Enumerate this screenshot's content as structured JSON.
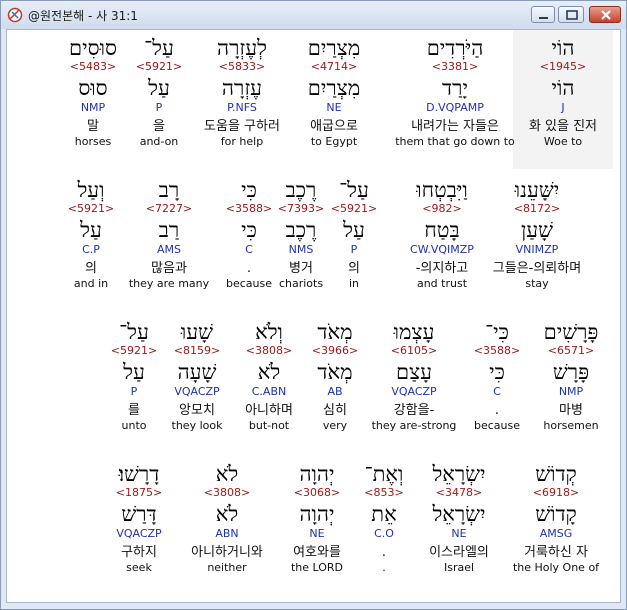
{
  "window": {
    "title": "@원전본해 - 사 31:1"
  },
  "rows": [
    [
      {
        "heb": "הוֹי",
        "num": "<1945>",
        "lex": "הוֹי",
        "morph": "J",
        "kor": "화 있을 진저",
        "eng": "Woe to",
        "highlight": true
      },
      {
        "heb": "הַיֹּרְדִים",
        "num": "<3381>",
        "lex": "יָרַד",
        "morph": "D.VQPAMP",
        "kor": "내려가는 자들은",
        "eng": "them that go down to"
      },
      {
        "heb": "מִצְרַיִם",
        "num": "<4714>",
        "lex": "מִצְרַיִם",
        "morph": "NE",
        "kor": "애굽으로",
        "eng": "to Egypt"
      },
      {
        "heb": "לְעֶזְרָה",
        "num": "<5833>",
        "lex": "עֶזְרָה",
        "morph": "P.NFS",
        "kor": "도움을 구하러",
        "eng": "for help"
      },
      {
        "heb": "עַל־",
        "num": "<5921>",
        "lex": "עַל",
        "morph": "P",
        "kor": "을",
        "eng": "and-on"
      },
      {
        "heb": "סוּסִים",
        "num": "<5483>",
        "lex": "סוּס",
        "morph": "NMP",
        "kor": "말",
        "eng": "horses"
      }
    ],
    [
      {
        "heb": "יִשָּׁעֵנוּ",
        "num": "<8172>",
        "lex": "שָׁעַן",
        "morph": "VNIMZP",
        "kor": "그들은-의뢰하며",
        "eng": "stay"
      },
      {
        "heb": "וַיִּבְטְחוּ",
        "num": "<982>",
        "lex": "בָּטַח",
        "morph": "CW.VQIMZP",
        "kor": "-의지하고",
        "eng": "and trust"
      },
      {
        "heb": "עַל־",
        "num": "<5921>",
        "lex": "עַל",
        "morph": "P",
        "kor": "의",
        "eng": "in"
      },
      {
        "heb": "רֶכֶב",
        "num": "<7393>",
        "lex": "רֶכֶב",
        "morph": "NMS",
        "kor": "병거",
        "eng": "chariots"
      },
      {
        "heb": "כִּי",
        "num": "<3588>",
        "lex": "כִּי",
        "morph": "C",
        "kor": ".",
        "eng": "because"
      },
      {
        "heb": "רָב",
        "num": "<7227>",
        "lex": "רַב",
        "morph": "AMS",
        "kor": "많음과",
        "eng": "they are many"
      },
      {
        "heb": "וְעַל",
        "num": "<5921>",
        "lex": "עַל",
        "morph": "C.P",
        "kor": "의",
        "eng": "and in"
      }
    ],
    [
      {
        "heb": "פָּרָשִׁים",
        "num": "<6571>",
        "lex": "פָּרָשׁ",
        "morph": "NMP",
        "kor": "마병",
        "eng": "horsemen"
      },
      {
        "heb": "כִּי־",
        "num": "<3588>",
        "lex": "כִּי",
        "morph": "C",
        "kor": ".",
        "eng": "because"
      },
      {
        "heb": "עָצְמוּ",
        "num": "<6105>",
        "lex": "עָצַם",
        "morph": "VQACZP",
        "kor": "강함을-",
        "eng": "they are-strong"
      },
      {
        "heb": "מְאֹד",
        "num": "<3966>",
        "lex": "מְאֹד",
        "morph": "AB",
        "kor": "심히",
        "eng": "very"
      },
      {
        "heb": "וְלֹא",
        "num": "<3808>",
        "lex": "לֹא",
        "morph": "C.ABN",
        "kor": "아니하며",
        "eng": "but-not"
      },
      {
        "heb": "שָׁעוּ",
        "num": "<8159>",
        "lex": "שָׁעָה",
        "morph": "VQACZP",
        "kor": "앙모치",
        "eng": "they look"
      },
      {
        "heb": "עַל־",
        "num": "<5921>",
        "lex": "עַל",
        "morph": "P",
        "kor": "를",
        "eng": "unto"
      }
    ],
    [
      {
        "heb": "קְדוֹשׁ",
        "num": "<6918>",
        "lex": "קָדוֹשׁ",
        "morph": "AMSG",
        "kor": "거룩하신 자",
        "eng": "the Holy One of"
      },
      {
        "heb": "יִשְׂרָאֵל",
        "num": "<3478>",
        "lex": "יִשְׂרָאֵל",
        "morph": "NE",
        "kor": "이스라엘의",
        "eng": "Israel"
      },
      {
        "heb": "וְאֶת־",
        "num": "<853>",
        "lex": "אֵת",
        "morph": "C.O",
        "kor": ".",
        "eng": "."
      },
      {
        "heb": "יְהוָה",
        "num": "<3068>",
        "lex": "יְהוָה",
        "morph": "NE",
        "kor": "여호와를",
        "eng": "the LORD"
      },
      {
        "heb": "לֹא",
        "num": "<3808>",
        "lex": "לֹא",
        "morph": "ABN",
        "kor": "아니하거니와",
        "eng": "neither"
      },
      {
        "heb": "דָרָשׁוּ׃",
        "num": "<1875>",
        "lex": "דָּרַשׁ",
        "morph": "VQACZP",
        "kor": "구하지",
        "eng": "seek"
      }
    ]
  ]
}
